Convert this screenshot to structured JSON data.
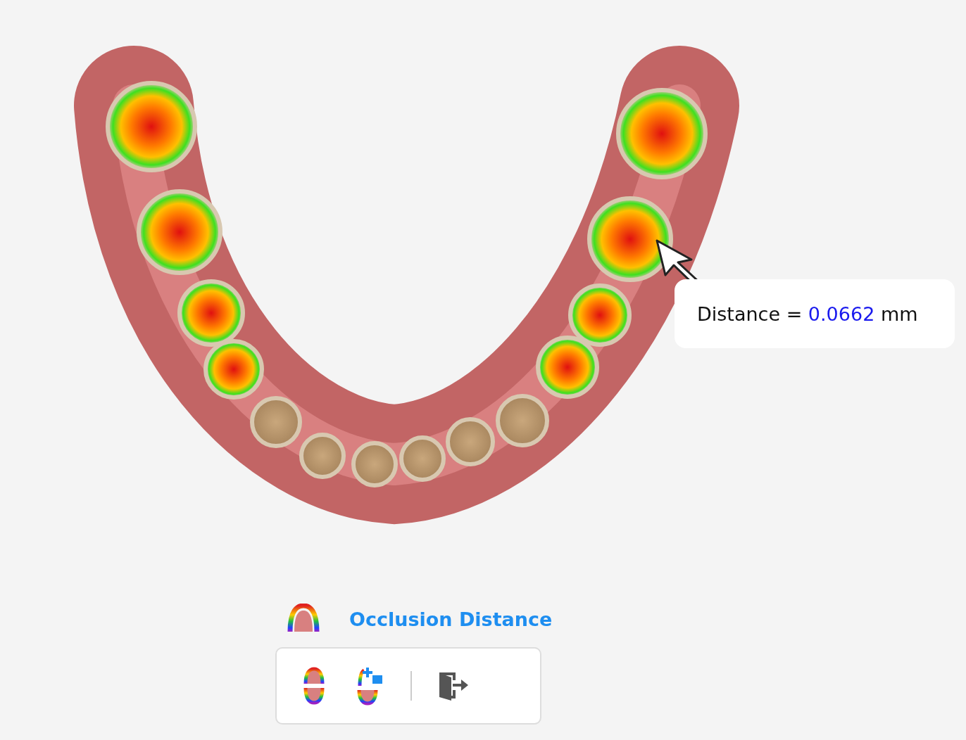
{
  "measurement": {
    "label": "Distance =",
    "value": "0.0662",
    "unit": "mm"
  },
  "tool": {
    "title": "Occlusion Distance"
  }
}
